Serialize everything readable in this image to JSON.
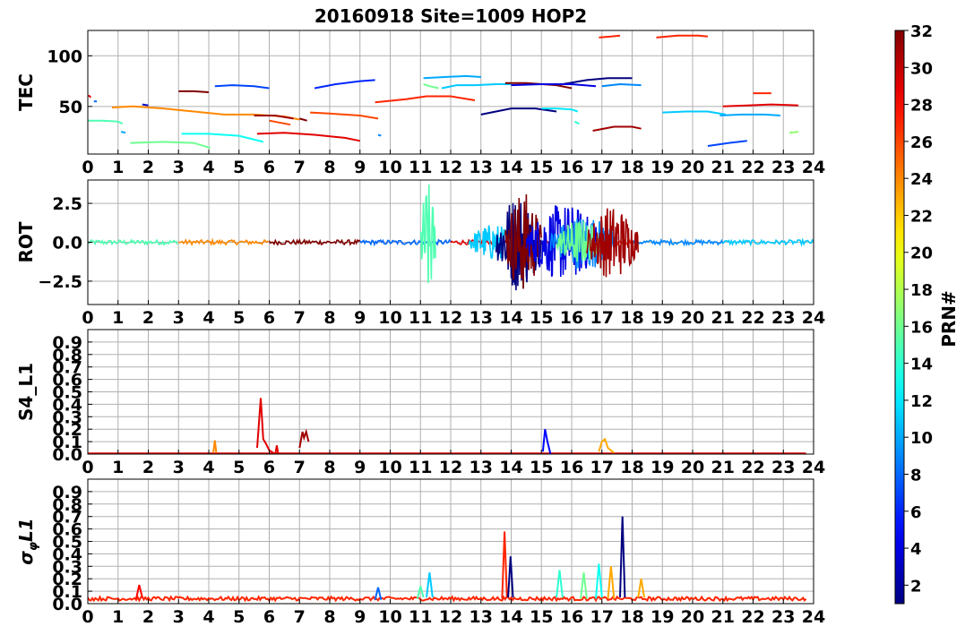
{
  "title": "20160918 Site=1009 HOP2",
  "colorbar": {
    "label": "PRN#",
    "range": [
      1,
      32
    ],
    "ticks": [
      2,
      4,
      6,
      8,
      10,
      12,
      14,
      16,
      18,
      20,
      22,
      24,
      26,
      28,
      30,
      32
    ],
    "colormap": "jet"
  },
  "chart_data": [
    {
      "type": "line",
      "ylabel": "TEC",
      "xlim": [
        0,
        24
      ],
      "ylim": [
        3,
        125
      ],
      "xticks": [
        0,
        1,
        2,
        3,
        4,
        5,
        6,
        7,
        8,
        9,
        10,
        11,
        12,
        13,
        14,
        15,
        16,
        17,
        18,
        19,
        20,
        21,
        22,
        23,
        24
      ],
      "yticks": [
        50,
        100
      ],
      "ytick_labels": [
        "50",
        "100"
      ],
      "grid": true,
      "series": [
        {
          "prn": 29,
          "x": [
            0.02,
            0.1
          ],
          "y": [
            61,
            59
          ]
        },
        {
          "prn": 8,
          "x": [
            0.2,
            0.3
          ],
          "y": [
            55,
            55
          ]
        },
        {
          "prn": 15,
          "x": [
            0.0,
            0.5,
            1.0,
            1.15
          ],
          "y": [
            36,
            36,
            35,
            33
          ]
        },
        {
          "prn": 10,
          "x": [
            1.1,
            1.25
          ],
          "y": [
            25,
            24
          ]
        },
        {
          "prn": 24,
          "x": [
            0.8,
            1.5,
            2.5,
            3.5,
            4.5,
            5.5,
            6.5,
            7.0
          ],
          "y": [
            49,
            50,
            48,
            45,
            42,
            42,
            40,
            37
          ]
        },
        {
          "prn": 3,
          "x": [
            1.8,
            2.0
          ],
          "y": [
            52,
            51
          ]
        },
        {
          "prn": 16,
          "x": [
            1.4,
            2.5,
            3.5,
            4.05
          ],
          "y": [
            14,
            15,
            14,
            9
          ]
        },
        {
          "prn": 32,
          "x": [
            3.0,
            3.5,
            4.0
          ],
          "y": [
            65,
            65,
            64
          ]
        },
        {
          "prn": 13,
          "x": [
            3.1,
            4.0,
            5.0,
            5.8
          ],
          "y": [
            23,
            23,
            21,
            15
          ]
        },
        {
          "prn": 7,
          "x": [
            4.2,
            4.8,
            5.5,
            6.0
          ],
          "y": [
            70,
            71,
            70,
            68
          ]
        },
        {
          "prn": 31,
          "x": [
            5.5,
            6.2,
            6.8
          ],
          "y": [
            41,
            41,
            38
          ]
        },
        {
          "prn": 29,
          "x": [
            5.6,
            6.5,
            7.5,
            8.5,
            9.0
          ],
          "y": [
            23,
            24,
            22,
            19,
            16
          ]
        },
        {
          "prn": 26,
          "x": [
            6.0,
            6.7
          ],
          "y": [
            36,
            32
          ]
        },
        {
          "prn": 32,
          "x": [
            7.0,
            7.25
          ],
          "y": [
            38,
            36
          ]
        },
        {
          "prn": 6,
          "x": [
            7.5,
            8.2,
            9.0,
            9.5
          ],
          "y": [
            68,
            72,
            75,
            76
          ]
        },
        {
          "prn": 26,
          "x": [
            7.35,
            8.0,
            9.0,
            9.6
          ],
          "y": [
            44,
            43,
            41,
            38
          ]
        },
        {
          "prn": 9,
          "x": [
            9.6,
            9.7
          ],
          "y": [
            22,
            21
          ]
        },
        {
          "prn": 27,
          "x": [
            9.5,
            10.5,
            11.2,
            12.0,
            12.8
          ],
          "y": [
            54,
            57,
            60,
            60,
            56
          ]
        },
        {
          "prn": 16,
          "x": [
            11.1,
            11.3,
            11.6
          ],
          "y": [
            72,
            70,
            68
          ]
        },
        {
          "prn": 10,
          "x": [
            11.1,
            11.8,
            12.5,
            13.0
          ],
          "y": [
            78,
            79,
            80,
            79
          ]
        },
        {
          "prn": 11,
          "x": [
            11.7,
            12.2,
            12.8,
            13.5,
            14.0
          ],
          "y": [
            68,
            71,
            71,
            72,
            72
          ]
        },
        {
          "prn": 1,
          "x": [
            13.0,
            13.5,
            14.0,
            14.8,
            15.5
          ],
          "y": [
            42,
            45,
            48,
            48,
            45
          ]
        },
        {
          "prn": 32,
          "x": [
            13.8,
            14.5,
            15.5,
            16.0
          ],
          "y": [
            73,
            73,
            71,
            68
          ]
        },
        {
          "prn": 1,
          "x": [
            15.7,
            16.5,
            17.2,
            18.0
          ],
          "y": [
            72,
            76,
            78,
            78
          ]
        },
        {
          "prn": 4,
          "x": [
            14.0,
            15.0,
            16.0,
            16.8
          ],
          "y": [
            71,
            72,
            72,
            70
          ]
        },
        {
          "prn": 12,
          "x": [
            15.0,
            15.5,
            16.0,
            16.2
          ],
          "y": [
            48,
            48,
            47,
            45
          ]
        },
        {
          "prn": 14,
          "x": [
            16.1,
            16.25
          ],
          "y": [
            35,
            33
          ]
        },
        {
          "prn": 9,
          "x": [
            17.0,
            17.6,
            18.3
          ],
          "y": [
            70,
            72,
            71
          ]
        },
        {
          "prn": 31,
          "x": [
            16.7,
            17.4,
            18.0,
            18.3
          ],
          "y": [
            26,
            30,
            30,
            28
          ]
        },
        {
          "prn": 27,
          "x": [
            16.9,
            17.3,
            17.6
          ],
          "y": [
            118,
            119,
            120
          ]
        },
        {
          "prn": 27,
          "x": [
            18.8,
            19.5,
            20.2,
            20.5
          ],
          "y": [
            118,
            120,
            120,
            119
          ]
        },
        {
          "prn": 11,
          "x": [
            19.0,
            19.8,
            20.5,
            21.1
          ],
          "y": [
            44,
            45,
            45,
            42
          ]
        },
        {
          "prn": 10,
          "x": [
            20.9,
            21.6,
            22.4,
            22.9
          ],
          "y": [
            41,
            42,
            42,
            41
          ]
        },
        {
          "prn": 7,
          "x": [
            20.5,
            21.2,
            21.8
          ],
          "y": [
            11,
            14,
            16
          ]
        },
        {
          "prn": 29,
          "x": [
            21.0,
            21.8,
            22.6,
            23.5
          ],
          "y": [
            50,
            51,
            52,
            51
          ]
        },
        {
          "prn": 27,
          "x": [
            22.0,
            22.3,
            22.6
          ],
          "y": [
            63,
            63,
            63
          ]
        },
        {
          "prn": 17,
          "x": [
            23.2,
            23.5
          ],
          "y": [
            24,
            25
          ]
        }
      ]
    },
    {
      "type": "line",
      "ylabel": "ROT",
      "xlim": [
        0,
        24
      ],
      "ylim": [
        -4,
        4
      ],
      "xticks": [
        0,
        1,
        2,
        3,
        4,
        5,
        6,
        7,
        8,
        9,
        10,
        11,
        12,
        13,
        14,
        15,
        16,
        17,
        18,
        19,
        20,
        21,
        22,
        23,
        24
      ],
      "yticks": [
        -2.5,
        0.0,
        2.5
      ],
      "ytick_labels": [
        "−2.5",
        "0.0",
        "2.5"
      ],
      "grid": true,
      "activity_bursts": [
        {
          "prn": 15,
          "x_start": 11.0,
          "x_end": 11.5,
          "max_abs": 3.9
        },
        {
          "prn": 11,
          "x_start": 12.6,
          "x_end": 14.2,
          "max_abs": 1.2
        },
        {
          "prn": 1,
          "x_start": 13.5,
          "x_end": 15.0,
          "max_abs": 3.2
        },
        {
          "prn": 32,
          "x_start": 13.8,
          "x_end": 15.0,
          "max_abs": 3.3
        },
        {
          "prn": 4,
          "x_start": 14.5,
          "x_end": 17.0,
          "max_abs": 2.5
        },
        {
          "prn": 9,
          "x_start": 15.3,
          "x_end": 17.5,
          "max_abs": 1.8
        },
        {
          "prn": 16,
          "x_start": 15.5,
          "x_end": 17.0,
          "max_abs": 1.5
        },
        {
          "prn": 31,
          "x_start": 16.5,
          "x_end": 18.2,
          "max_abs": 2.4
        }
      ],
      "baseline_noise": 0.3
    },
    {
      "type": "line",
      "ylabel": "S4_L1",
      "xlim": [
        0,
        24
      ],
      "ylim": [
        0,
        1
      ],
      "xticks": [
        0,
        1,
        2,
        3,
        4,
        5,
        6,
        7,
        8,
        9,
        10,
        11,
        12,
        13,
        14,
        15,
        16,
        17,
        18,
        19,
        20,
        21,
        22,
        23,
        24
      ],
      "yticks": [
        0.0,
        0.1,
        0.2,
        0.3,
        0.4,
        0.5,
        0.6,
        0.7,
        0.8,
        0.9
      ],
      "ytick_labels": [
        "0.0",
        "0.1",
        "0.2",
        "0.3",
        "0.4",
        "0.5",
        "0.6",
        "0.7",
        "0.8",
        "0.9"
      ],
      "grid": true,
      "series": [
        {
          "prn": 24,
          "x": [
            4.15,
            4.2,
            4.25
          ],
          "y": [
            0.01,
            0.11,
            0.01
          ]
        },
        {
          "prn": 29,
          "x": [
            5.6,
            5.72,
            5.8,
            5.9,
            6.0,
            6.2,
            6.25,
            6.3
          ],
          "y": [
            0.05,
            0.45,
            0.12,
            0.08,
            0.03,
            0.0,
            0.07,
            0.0
          ]
        },
        {
          "prn": 31,
          "x": [
            7.0,
            7.1,
            7.15,
            7.22,
            7.3
          ],
          "y": [
            0.05,
            0.18,
            0.13,
            0.18,
            0.1
          ]
        },
        {
          "prn": 5,
          "x": [
            15.05,
            15.12,
            15.2,
            15.3
          ],
          "y": [
            0.02,
            0.2,
            0.1,
            0.0
          ]
        },
        {
          "prn": 23,
          "x": [
            16.9,
            17.0,
            17.1,
            17.2,
            17.4
          ],
          "y": [
            0.02,
            0.1,
            0.12,
            0.05,
            0.01
          ]
        }
      ],
      "baseline": 0.005
    },
    {
      "type": "line",
      "ylabel": "σφL1",
      "xlim": [
        0,
        24
      ],
      "ylim": [
        0,
        1
      ],
      "xticks": [
        0,
        1,
        2,
        3,
        4,
        5,
        6,
        7,
        8,
        9,
        10,
        11,
        12,
        13,
        14,
        15,
        16,
        17,
        18,
        19,
        20,
        21,
        22,
        23,
        24
      ],
      "yticks": [
        0.0,
        0.1,
        0.2,
        0.3,
        0.4,
        0.5,
        0.6,
        0.7,
        0.8,
        0.9
      ],
      "ytick_labels": [
        "0.0",
        "0.1",
        "0.2",
        "0.3",
        "0.4",
        "0.5",
        "0.6",
        "0.7",
        "0.8",
        "0.9"
      ],
      "grid": true,
      "series": [
        {
          "prn": 28,
          "x": [
            1.6,
            1.7,
            1.8
          ],
          "y": [
            0.04,
            0.15,
            0.05
          ]
        },
        {
          "prn": 8,
          "x": [
            9.5,
            9.6,
            9.7
          ],
          "y": [
            0.03,
            0.13,
            0.03
          ]
        },
        {
          "prn": 15,
          "x": [
            10.9,
            11.0,
            11.1
          ],
          "y": [
            0.04,
            0.14,
            0.05
          ]
        },
        {
          "prn": 11,
          "x": [
            11.2,
            11.3,
            11.4
          ],
          "y": [
            0.05,
            0.25,
            0.05
          ]
        },
        {
          "prn": 27,
          "x": [
            13.7,
            13.78,
            13.86
          ],
          "y": [
            0.04,
            0.58,
            0.05
          ]
        },
        {
          "prn": 1,
          "x": [
            13.9,
            13.98,
            14.06
          ],
          "y": [
            0.05,
            0.38,
            0.05
          ]
        },
        {
          "prn": 14,
          "x": [
            15.5,
            15.6,
            15.7
          ],
          "y": [
            0.05,
            0.27,
            0.05
          ]
        },
        {
          "prn": 16,
          "x": [
            16.3,
            16.4,
            16.5
          ],
          "y": [
            0.04,
            0.25,
            0.04
          ]
        },
        {
          "prn": 13,
          "x": [
            16.8,
            16.9,
            17.0
          ],
          "y": [
            0.04,
            0.32,
            0.05
          ]
        },
        {
          "prn": 23,
          "x": [
            17.2,
            17.3,
            17.4
          ],
          "y": [
            0.04,
            0.3,
            0.04
          ]
        },
        {
          "prn": 1,
          "x": [
            17.6,
            17.68,
            17.76
          ],
          "y": [
            0.05,
            0.7,
            0.05
          ]
        },
        {
          "prn": 23,
          "x": [
            18.2,
            18.3,
            18.4
          ],
          "y": [
            0.05,
            0.2,
            0.05
          ]
        }
      ],
      "baseline": 0.04
    }
  ]
}
